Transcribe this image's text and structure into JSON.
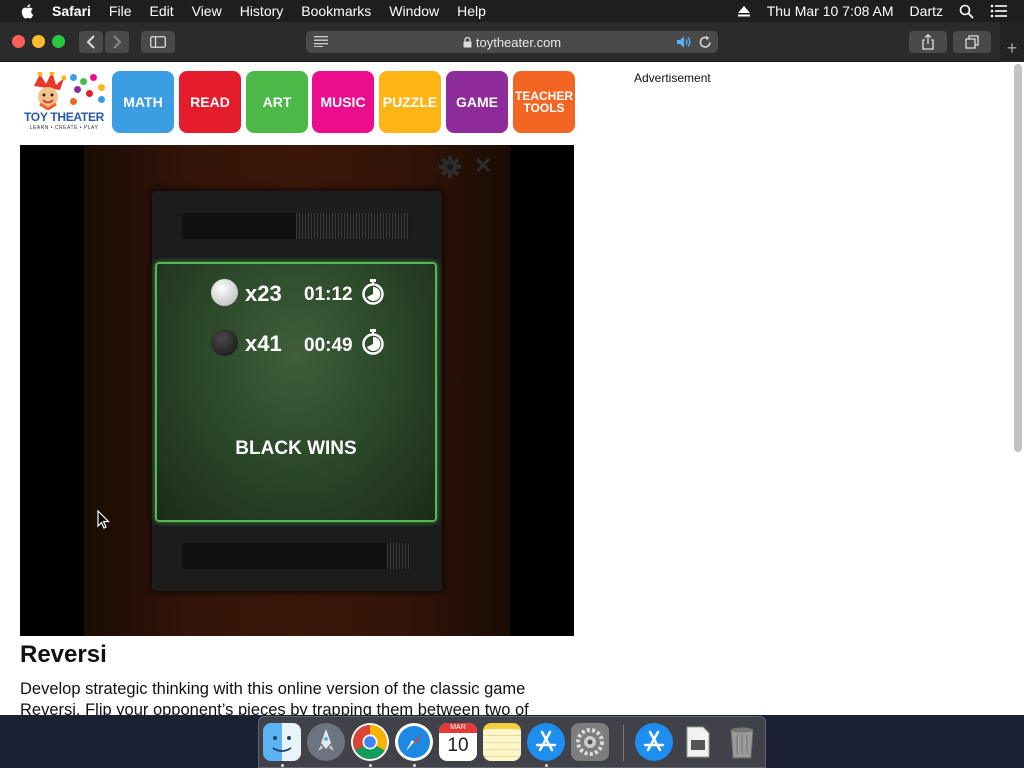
{
  "menubar": {
    "app_name": "Safari",
    "menus": [
      "File",
      "Edit",
      "View",
      "History",
      "Bookmarks",
      "Window",
      "Help"
    ],
    "datetime": "Thu Mar 10  7:08 AM",
    "user": "Dartz"
  },
  "toolbar": {
    "url": "toytheater.com"
  },
  "site": {
    "logo_name": "TOY THEATER",
    "logo_tagline": "LEARN • CREATE • PLAY",
    "nav": [
      {
        "label": "MATH",
        "color": "#3b9ee3"
      },
      {
        "label": "READ",
        "color": "#e41c2b"
      },
      {
        "label": "ART",
        "color": "#4cb848"
      },
      {
        "label": "MUSIC",
        "color": "#ec0d8c"
      },
      {
        "label": "PUZZLE",
        "color": "#fdb515"
      },
      {
        "label": "GAME",
        "color": "#8e2b9a"
      },
      {
        "label": "TEACHER TOOLS",
        "color": "#f26522"
      }
    ],
    "advertisement": "Advertisement"
  },
  "game": {
    "white_count": "x23",
    "white_time": "01:12",
    "black_count": "x41",
    "black_time": "00:49",
    "result": "BLACK WINS",
    "white_timer_fill": 0.5,
    "black_timer_fill": 0.1,
    "panel_color": "#54b854"
  },
  "article": {
    "title": "Reversi",
    "description_line1": "Develop strategic thinking with this online version of the classic game",
    "description_line2": "Reversi.  Flip your opponent’s pieces by trapping them between two of"
  },
  "dock": {
    "apps": [
      "finder-icon",
      "launchpad-icon",
      "chrome-icon",
      "safari-icon",
      "calendar-icon",
      "notes-icon",
      "app-store-icon",
      "system-preferences-icon",
      "app-store-icon",
      "preview-icon",
      "trash-icon"
    ],
    "calendar_month": "MAR",
    "calendar_day": "10"
  }
}
